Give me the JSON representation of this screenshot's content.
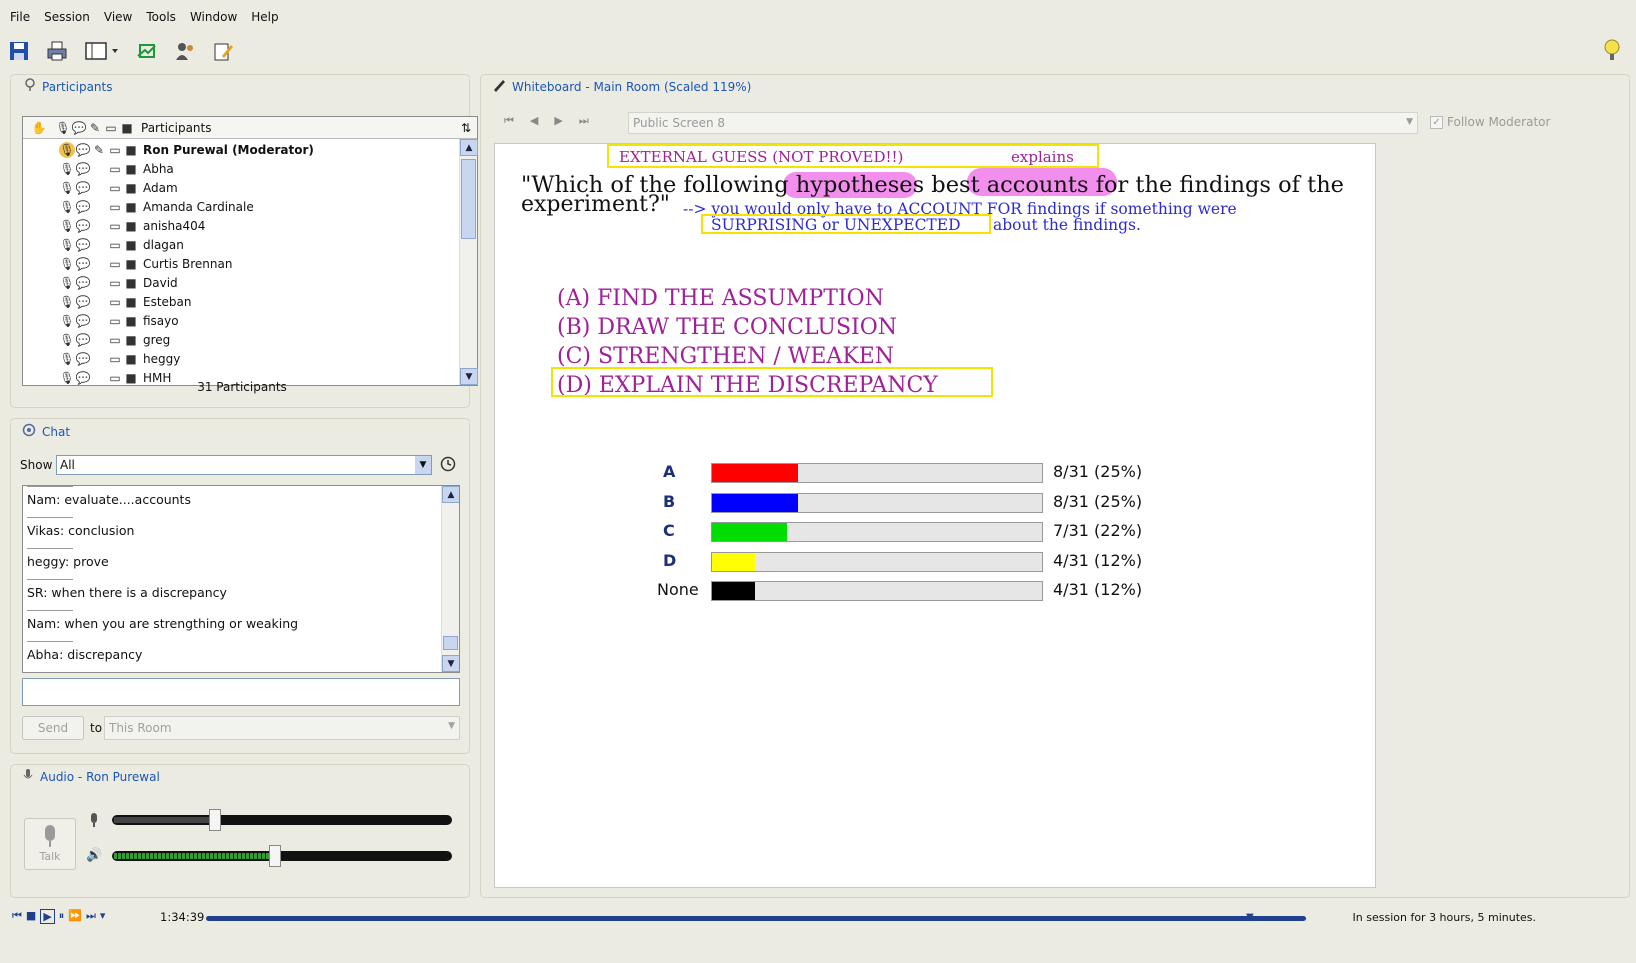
{
  "menu": [
    "File",
    "Session",
    "View",
    "Tools",
    "Window",
    "Help"
  ],
  "participants": {
    "title": "Participants",
    "header_label": "Participants",
    "rows": [
      {
        "name": "Ron Purewal (Moderator)",
        "bold": true
      },
      {
        "name": "Abha"
      },
      {
        "name": "Adam"
      },
      {
        "name": "Amanda Cardinale"
      },
      {
        "name": "anisha404"
      },
      {
        "name": "dlagan"
      },
      {
        "name": "Curtis Brennan"
      },
      {
        "name": "David"
      },
      {
        "name": "Esteban"
      },
      {
        "name": "fisayo"
      },
      {
        "name": "greg"
      },
      {
        "name": "heggy"
      },
      {
        "name": "HMH"
      }
    ],
    "count": "31 Participants"
  },
  "chat": {
    "title": "Chat",
    "show_label": "Show",
    "show_value": "All",
    "messages": [
      "Nam: evaluate....accounts",
      "Vikas: conclusion",
      "heggy: prove",
      "SR: when there is a discrepancy",
      "Nam: when you are strengthing or weaking",
      "Abha: discrepancy"
    ],
    "send_label": "Send",
    "to_label": "to",
    "to_value": "This Room"
  },
  "audio": {
    "title": "Audio - Ron Purewal",
    "talk_label": "Talk",
    "mic_level": 0.3,
    "speaker_level": 0.48
  },
  "whiteboard": {
    "title": "Whiteboard - Main Room (Scaled 119%)",
    "screen_name": "Public Screen 8",
    "follow_label": "Follow Moderator",
    "annot_top": "EXTERNAL GUESS (NOT PROVED!!)",
    "annot_explains": "explains",
    "question_line1": "\"Which of the following hypotheses best accounts for the findings of the",
    "question_line2": "experiment?\"",
    "annot_arrow": "--> you would only have to ACCOUNT FOR findings  if something were",
    "annot_surprising": "SURPRISING or UNEXPECTED",
    "annot_about": "about the findings.",
    "options": [
      "(A) FIND THE ASSUMPTION",
      "(B) DRAW THE CONCLUSION",
      "(C) STRENGTHEN / WEAKEN",
      "(D) EXPLAIN THE DISCREPANCY"
    ],
    "colors": {
      "ink_purple": "#a0209a",
      "ink_blue": "#2b2bd6",
      "highlight": "#f4e400",
      "marker_pink": "#f07ae8"
    }
  },
  "chart_data": {
    "type": "bar",
    "categories": [
      "A",
      "B",
      "C",
      "D",
      "None"
    ],
    "values": [
      8,
      8,
      7,
      4,
      4
    ],
    "total": 31,
    "value_labels": [
      "8/31 (25%)",
      "8/31 (25%)",
      "7/31 (22%)",
      "4/31 (12%)",
      "4/31 (12%)"
    ],
    "colors": [
      "#ff0000",
      "#0000ff",
      "#00dd00",
      "#ffff00",
      "#000000"
    ]
  },
  "playback": {
    "time": "1:34:39",
    "status": "In session for 3 hours, 5 minutes."
  }
}
